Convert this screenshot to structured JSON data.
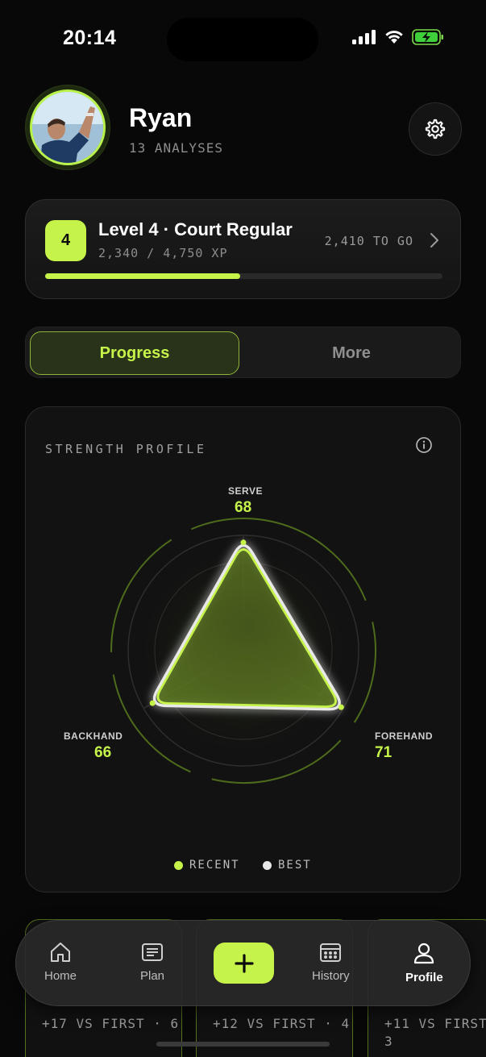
{
  "status": {
    "time": "20:14",
    "icons": [
      "signal-icon",
      "wifi-icon",
      "battery-charging-icon"
    ]
  },
  "profile": {
    "name": "Ryan",
    "analyses": "13 ANALYSES"
  },
  "level": {
    "badge": "4",
    "title": "Level 4 · Court Regular",
    "xp": "2,340 / 4,750 XP",
    "to_go": "2,410 TO GO",
    "progress_fraction": 0.49
  },
  "tabs": [
    {
      "label": "Progress",
      "active": true
    },
    {
      "label": "More",
      "active": false
    }
  ],
  "strength_profile": {
    "title": "STRENGTH PROFILE",
    "axes": [
      {
        "name": "SERVE",
        "value": "68"
      },
      {
        "name": "FOREHAND",
        "value": "71"
      },
      {
        "name": "BACKHAND",
        "value": "66"
      }
    ],
    "legend": [
      {
        "label": "RECENT",
        "color": "#c6f34a"
      },
      {
        "label": "BEST",
        "color": "#e8e8e8"
      }
    ]
  },
  "chart_data": {
    "type": "radar",
    "categories": [
      "SERVE",
      "FOREHAND",
      "BACKHAND"
    ],
    "series": [
      {
        "name": "RECENT",
        "values": [
          68,
          71,
          66
        ]
      },
      {
        "name": "BEST"
      }
    ]
  },
  "cards": [
    {
      "text": "+17 VS FIRST · 6"
    },
    {
      "text": "+12 VS FIRST · 4"
    },
    {
      "text": "+11 VS FIRST 3"
    }
  ],
  "nav": {
    "items": [
      {
        "label": "Home",
        "icon": "home-icon"
      },
      {
        "label": "Plan",
        "icon": "plan-icon"
      },
      {
        "label": "History",
        "icon": "calendar-icon"
      },
      {
        "label": "Profile",
        "icon": "profile-icon",
        "active": true
      }
    ],
    "add_icon": "plus-icon"
  },
  "colors": {
    "accent": "#c6f34a",
    "background": "#080808",
    "card": "#121212"
  }
}
